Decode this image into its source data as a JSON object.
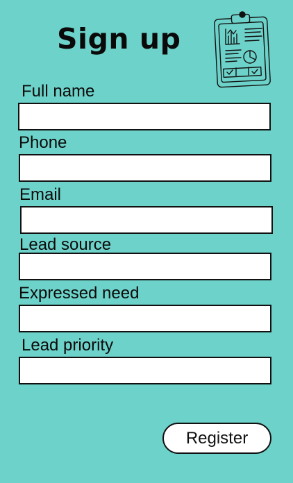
{
  "page": {
    "title": "Sign up",
    "illustration_icon": "clipboard-report-icon",
    "background_color": "#6dd2c9"
  },
  "form": {
    "fields": [
      {
        "label": "Full name",
        "value": "",
        "placeholder": ""
      },
      {
        "label": "Phone",
        "value": "",
        "placeholder": ""
      },
      {
        "label": "Email",
        "value": "",
        "placeholder": ""
      },
      {
        "label": "Lead source",
        "value": "",
        "placeholder": ""
      },
      {
        "label": "Expressed need",
        "value": "",
        "placeholder": ""
      },
      {
        "label": "Lead priority",
        "value": "",
        "placeholder": ""
      }
    ],
    "submit_label": "Register"
  }
}
